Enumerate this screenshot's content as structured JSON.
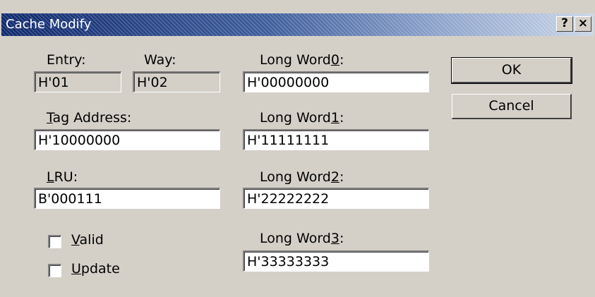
{
  "window": {
    "title": "Cache Modify",
    "help_glyph": "?",
    "close_glyph": "×"
  },
  "entry": {
    "label": "Entry:",
    "value": "H'01"
  },
  "way": {
    "label": "Way:",
    "value": "H'02"
  },
  "tag_address": {
    "label_prefix": "",
    "accel": "T",
    "label_rest": "ag Address:",
    "value": "H'10000000"
  },
  "lru": {
    "label_prefix": "",
    "accel": "L",
    "label_rest": "RU:",
    "value": "B'000111"
  },
  "valid": {
    "label_prefix": "",
    "accel": "V",
    "label_rest": "alid",
    "checked": false
  },
  "update": {
    "label_prefix": "",
    "accel": "U",
    "label_rest": "pdate",
    "checked": false
  },
  "long_words": [
    {
      "label_prefix": "Long Word",
      "accel": "0",
      "label_rest": ":",
      "value": "H'00000000"
    },
    {
      "label_prefix": "Long Word",
      "accel": "1",
      "label_rest": ":",
      "value": "H'11111111"
    },
    {
      "label_prefix": "Long Word",
      "accel": "2",
      "label_rest": ":",
      "value": "H'22222222"
    },
    {
      "label_prefix": "Long Word",
      "accel": "3",
      "label_rest": ":",
      "value": "H'33333333"
    }
  ],
  "buttons": {
    "ok": "OK",
    "cancel": "Cancel"
  }
}
